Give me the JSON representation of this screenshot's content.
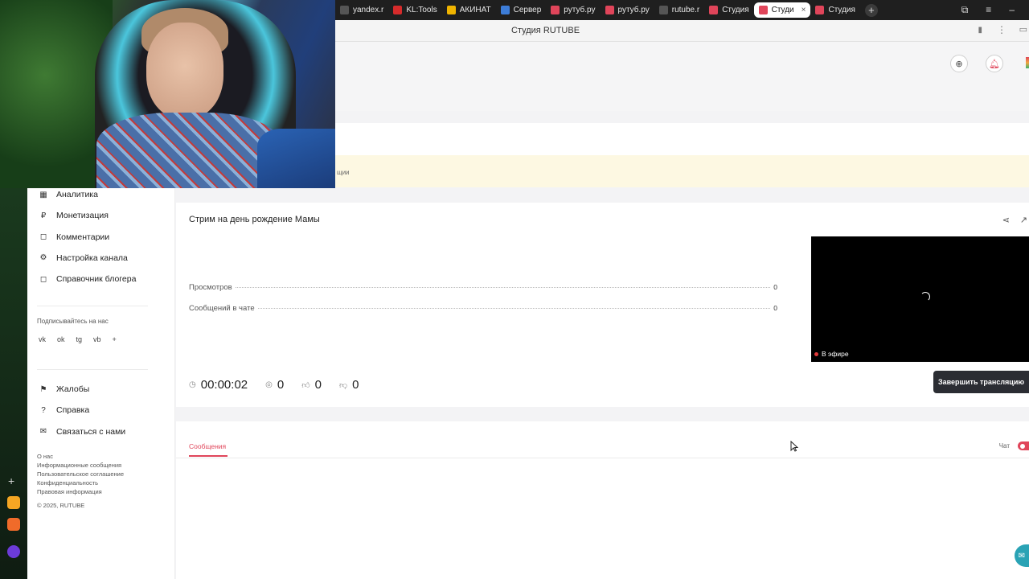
{
  "browser": {
    "tabs": [
      {
        "label": "yandex.r",
        "color": "#555555"
      },
      {
        "label": "KL:Tools",
        "color": "#d62b2b"
      },
      {
        "label": "АКИНАТ",
        "color": "#f0b400"
      },
      {
        "label": "Сервер",
        "color": "#3d7dd8"
      },
      {
        "label": "рутуб.ру",
        "color": "#e0455a"
      },
      {
        "label": "рутуб.ру",
        "color": "#e0455a"
      },
      {
        "label": "rutube.r",
        "color": "#555555"
      },
      {
        "label": "Студия",
        "color": "#e0455a"
      },
      {
        "label": "Студи",
        "color": "#e0455a",
        "active": true
      },
      {
        "label": "Студия",
        "color": "#e0455a"
      }
    ],
    "new_tab": "+",
    "close_tab": "×",
    "page_title": "Студия RUTUBE"
  },
  "banner": {
    "fragment": "щии"
  },
  "sidebar": {
    "items": [
      {
        "label": "Аналитика",
        "icon": "analytics-icon",
        "glyph": "▦"
      },
      {
        "label": "Монетизация",
        "icon": "ruble-icon",
        "glyph": "₽"
      },
      {
        "label": "Комментарии",
        "icon": "comment-icon",
        "glyph": "◻"
      },
      {
        "label": "Настройка канала",
        "icon": "gear-icon",
        "glyph": "⚙"
      },
      {
        "label": "Справочник блогера",
        "icon": "book-icon",
        "glyph": "◻"
      }
    ],
    "follow_label": "Подписывайтесь на нас",
    "social": [
      "vk",
      "ok",
      "tg",
      "vb",
      "+"
    ],
    "secondary": [
      {
        "label": "Жалобы",
        "icon": "flag-icon",
        "glyph": "⚑"
      },
      {
        "label": "Справка",
        "icon": "help-icon",
        "glyph": "?"
      },
      {
        "label": "Связаться с нами",
        "icon": "mail-icon",
        "glyph": "✉"
      }
    ],
    "footer": [
      "О нас",
      "Информационные сообщения",
      "Пользовательское соглашение",
      "Конфиденциальность",
      "Правовая информация"
    ],
    "copyright": "© 2025, RUTUBE"
  },
  "stream": {
    "title": "Стрим на день рождение Мамы",
    "stats": [
      {
        "label": "Просмотров",
        "value": "0"
      },
      {
        "label": "Сообщений в чате",
        "value": "0"
      }
    ],
    "live_badge": "В эфире",
    "timer": "00:00:02",
    "viewers": "0",
    "likes": "0",
    "dislikes": "0",
    "end_button": "Завершить трансляцию"
  },
  "messages": {
    "tab": "Сообщения",
    "chat_label": "Чат"
  },
  "colors": {
    "accent": "#e0455a",
    "dark_button": "#2b2d33"
  }
}
